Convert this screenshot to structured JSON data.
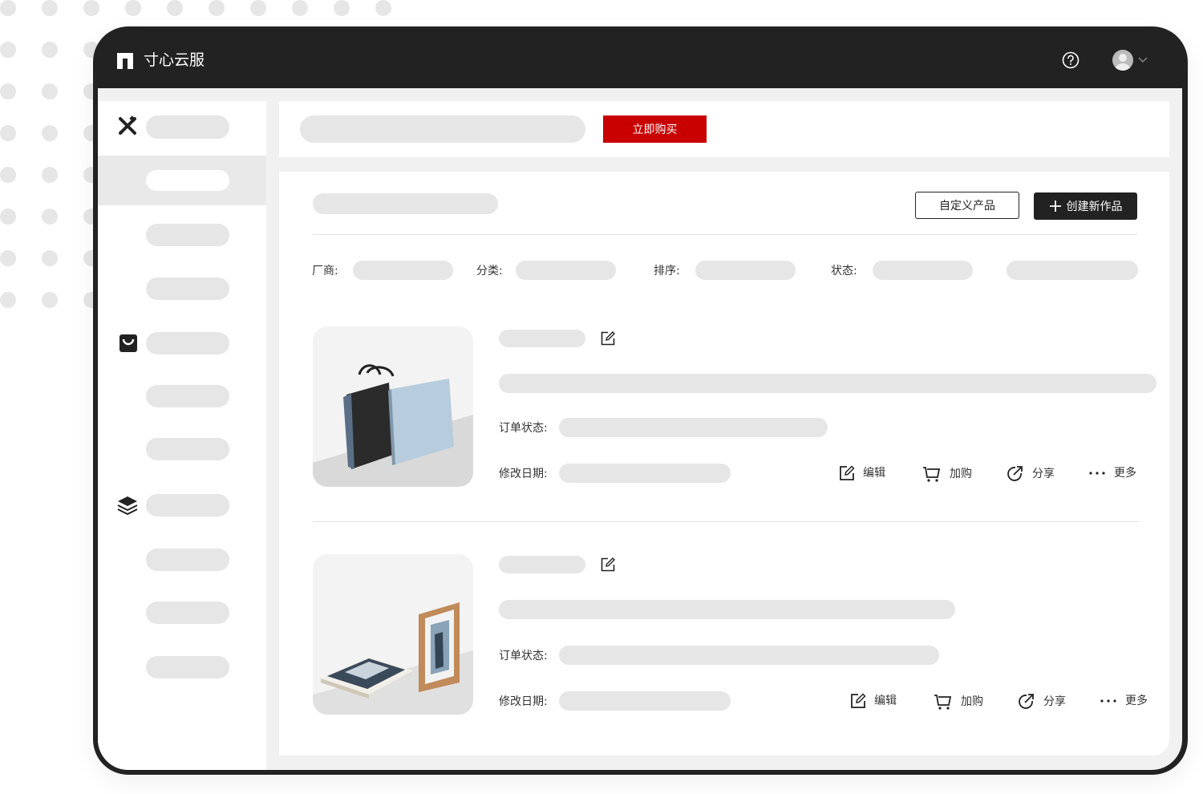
{
  "app": {
    "title": "寸心云服"
  },
  "topbar": {
    "help_icon": "help-icon",
    "avatar_icon": "avatar-icon",
    "caret_icon": "chevron-down-icon"
  },
  "sidebar": {
    "section_icons": [
      "design-tools-icon",
      "shopping-bag-icon",
      "layers-icon"
    ]
  },
  "promo": {
    "buy_label": "立即购买"
  },
  "toolbar": {
    "custom_product_label": "自定义产品",
    "create_label": "创建新作品"
  },
  "filters": {
    "vendor_label": "厂商:",
    "category_label": "分类:",
    "sort_label": "排序:",
    "status_label": "状态:"
  },
  "works": [
    {
      "order_status_label": "订单状态:",
      "modified_label": "修改日期:",
      "actions": {
        "edit": "编辑",
        "add_to_cart": "加购",
        "share": "分享",
        "more": "更多"
      }
    },
    {
      "order_status_label": "订单状态:",
      "modified_label": "修改日期:",
      "actions": {
        "edit": "编辑",
        "add_to_cart": "加购",
        "share": "分享",
        "more": "更多"
      }
    }
  ],
  "colors": {
    "accent": "#c80000",
    "dark": "#222222",
    "placeholder": "#e6e6e6"
  }
}
